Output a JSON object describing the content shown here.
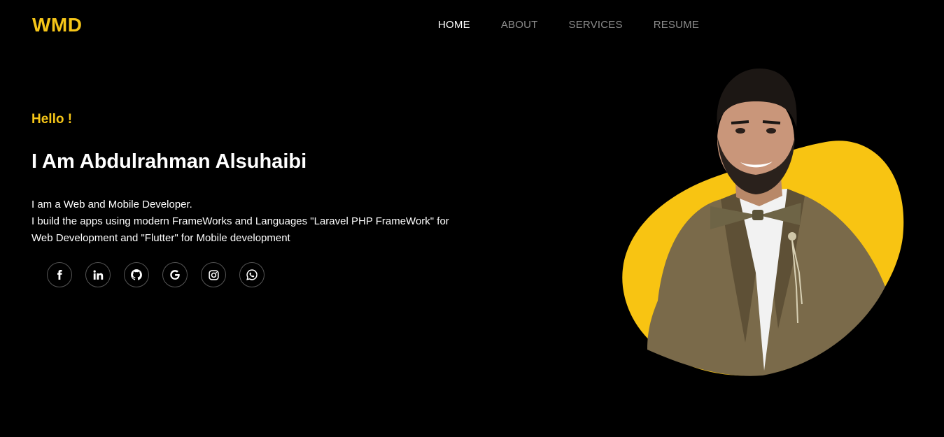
{
  "brand": {
    "logo": "WMD",
    "accent_color": "#f5c518"
  },
  "nav": {
    "items": [
      {
        "label": "HOME",
        "active": true
      },
      {
        "label": "ABOUT",
        "active": false
      },
      {
        "label": "SERVICES",
        "active": false
      },
      {
        "label": "RESUME",
        "active": false
      }
    ]
  },
  "hero": {
    "greeting": "Hello !",
    "headline": "I Am Abdulrahman Alsuhaibi",
    "description": [
      "I am a Web and Mobile Developer.",
      "I build the apps using modern FrameWorks and Languages \"Laravel PHP FrameWork\" for",
      "Web Development and \"Flutter\" for Mobile development"
    ]
  },
  "socials": [
    {
      "icon": "facebook-icon"
    },
    {
      "icon": "linkedin-icon"
    },
    {
      "icon": "github-icon"
    },
    {
      "icon": "google-icon"
    },
    {
      "icon": "instagram-icon"
    },
    {
      "icon": "whatsapp-icon"
    }
  ],
  "portrait": {
    "blob_color": "#f8c412",
    "suit_color": "#7a6a4a"
  }
}
